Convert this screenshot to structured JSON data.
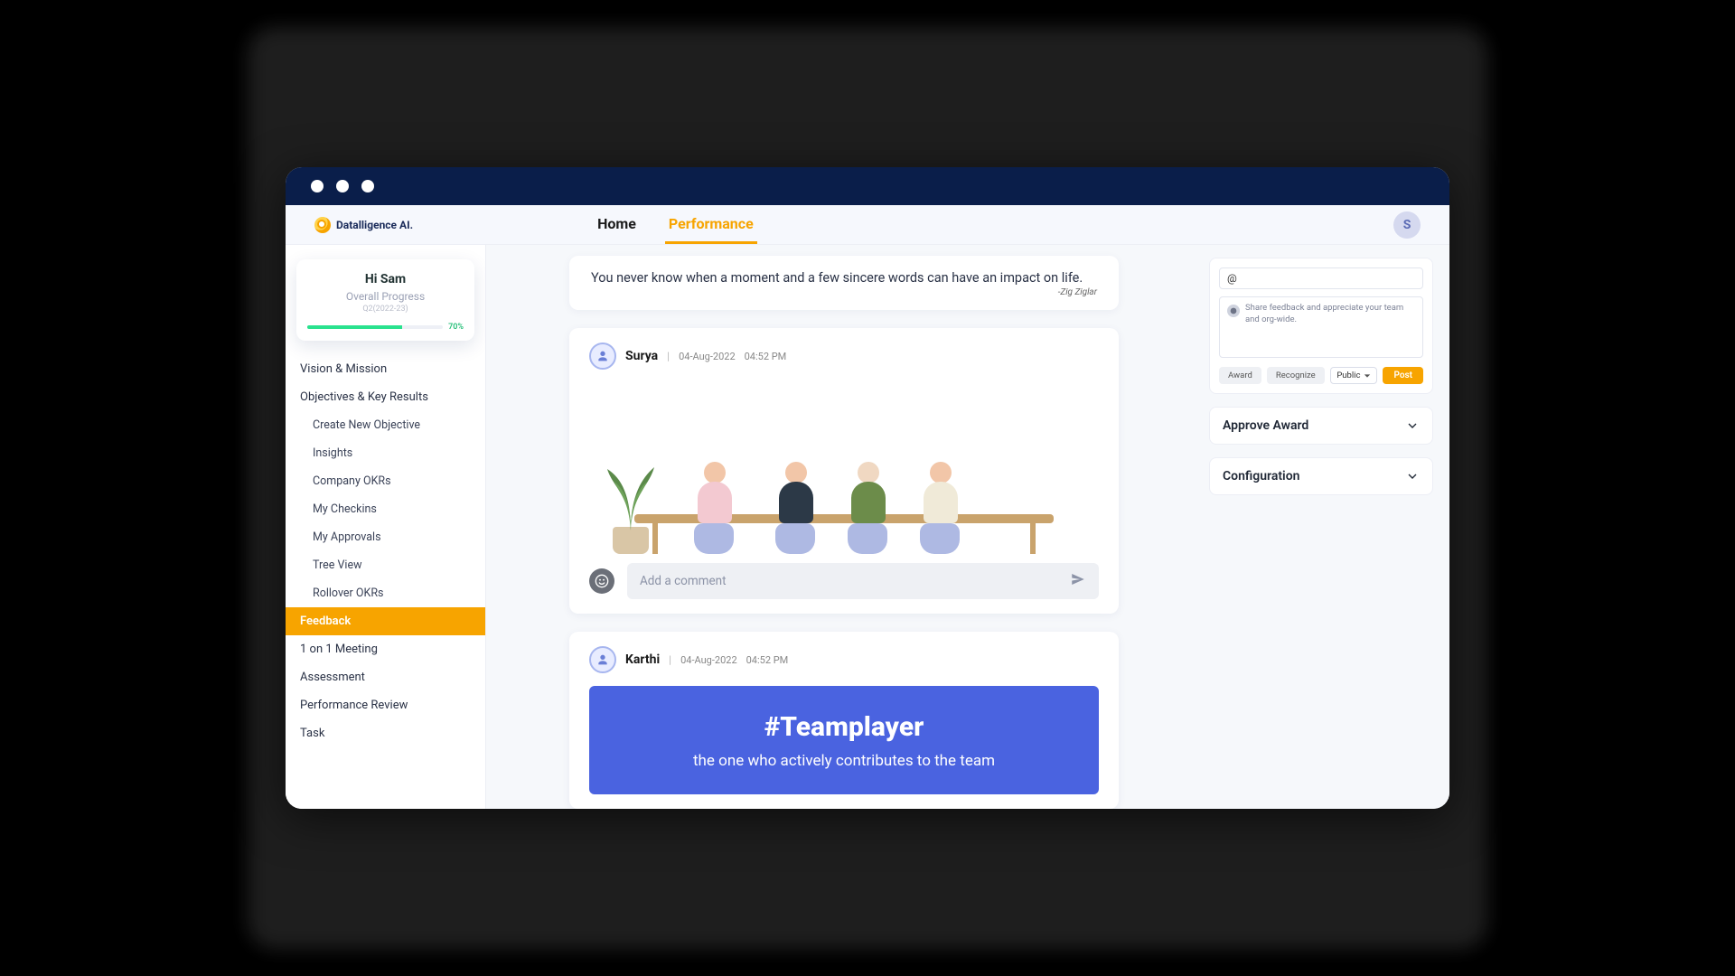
{
  "brand": {
    "name": "Datalligence AI."
  },
  "tabs": {
    "home": "Home",
    "performance": "Performance"
  },
  "avatar": {
    "initial": "S"
  },
  "sidebar": {
    "greeting_title": "Hi Sam",
    "greeting_sub": "Overall Progress",
    "greeting_period": "Q2(2022-23)",
    "progress_pct": "70%",
    "items": [
      {
        "label": "Vision & Mission"
      },
      {
        "label": "Objectives & Key Results"
      },
      {
        "label": "Create New Objective"
      },
      {
        "label": "Insights"
      },
      {
        "label": "Company OKRs"
      },
      {
        "label": "My  Checkins"
      },
      {
        "label": "My Approvals"
      },
      {
        "label": "Tree View"
      },
      {
        "label": "Rollover OKRs"
      },
      {
        "label": "Feedback"
      },
      {
        "label": "1 on 1 Meeting"
      },
      {
        "label": "Assessment"
      },
      {
        "label": "Performance Review"
      },
      {
        "label": "Task"
      }
    ]
  },
  "feed": {
    "quote_text": "You never know when a moment and a few sincere words can have an impact on life.",
    "quote_author": "-Zig Ziglar",
    "post1": {
      "name": "Surya",
      "date": "04-Aug-2022",
      "time": "04:52 PM",
      "comment_placeholder": "Add a comment"
    },
    "post2": {
      "name": "Karthi",
      "date": "04-Aug-2022",
      "time": "04:52 PM",
      "banner_tag": "#Teamplayer",
      "banner_desc": "the one who actively contributes to the team"
    }
  },
  "compose": {
    "at_placeholder": "@",
    "msg_placeholder": "Share feedback and appreciate your team and org-wide.",
    "award": "Award",
    "recognize": "Recognize",
    "visibility": "Public",
    "post": "Post"
  },
  "accordion": {
    "approve_award": "Approve Award",
    "configuration": "Configuration"
  }
}
